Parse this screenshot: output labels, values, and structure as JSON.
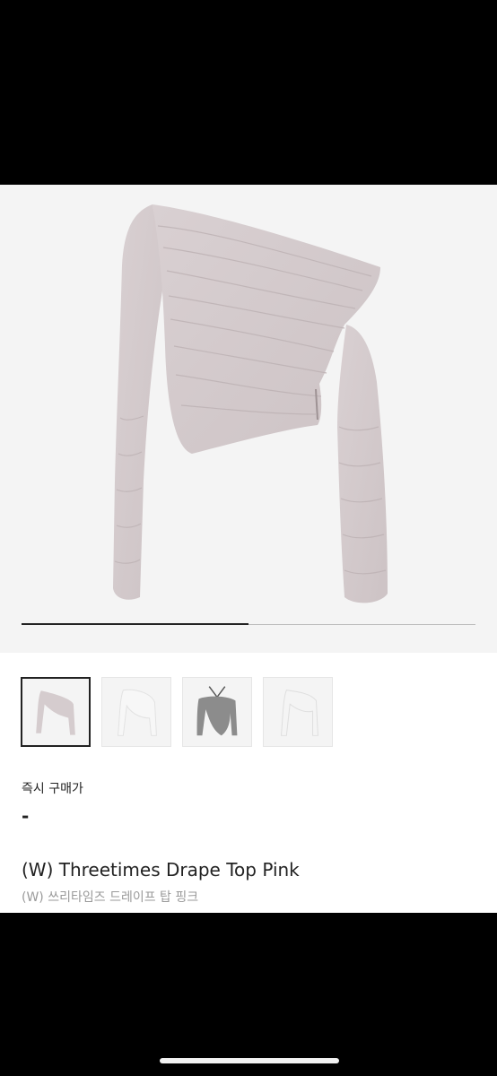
{
  "product": {
    "price_label": "즉시 구매가",
    "price_value": "-",
    "name_en": "(W) Threetimes Drape Top Pink",
    "name_ko": "(W) 쓰리타임즈 드레이프 탑 핑크"
  },
  "gallery": {
    "image_count": 4,
    "selected_index": 0,
    "progress_fraction": 0.5,
    "thumbnails": [
      {
        "alt": "pink drape top",
        "color": "#d5ccce"
      },
      {
        "alt": "white drape top",
        "color": "#f5f5f5"
      },
      {
        "alt": "grey halter drape top",
        "color": "#8c8c8c"
      },
      {
        "alt": "white off-shoulder drape top",
        "color": "#f2f2f2"
      }
    ]
  }
}
